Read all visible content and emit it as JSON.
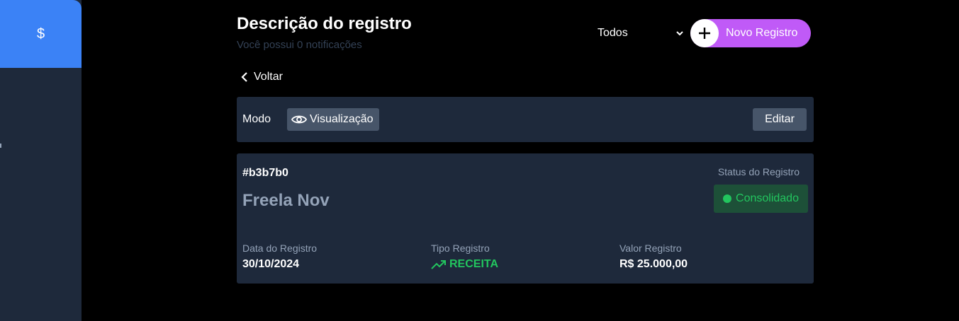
{
  "sidebar": {
    "active_icon": "$",
    "active_icon_name": "dollar-icon"
  },
  "header": {
    "title": "Descrição do registro",
    "subtitle": "Você possui 0 notificações",
    "filter_value": "Todos",
    "new_button_label": "Novo Registro"
  },
  "back": {
    "label": "Voltar"
  },
  "mode_bar": {
    "label": "Modo",
    "mode_value": "Visualização",
    "edit_label": "Editar"
  },
  "record": {
    "id": "#b3b7b0",
    "name": "Freela Nov",
    "status_label": "Status do Registro",
    "status_value": "Consolidado",
    "date_label": "Data do Registro",
    "date_value": "30/10/2024",
    "type_label": "Tipo Registro",
    "type_value": "RECEITA",
    "amount_label": "Valor Registro",
    "amount_value": "R$ 25.000,00"
  },
  "colors": {
    "sidebar": "#1e293b",
    "active": "#3b82f6",
    "accent": "#c05af7",
    "positive": "#22c55e",
    "card": "#1e293b"
  }
}
